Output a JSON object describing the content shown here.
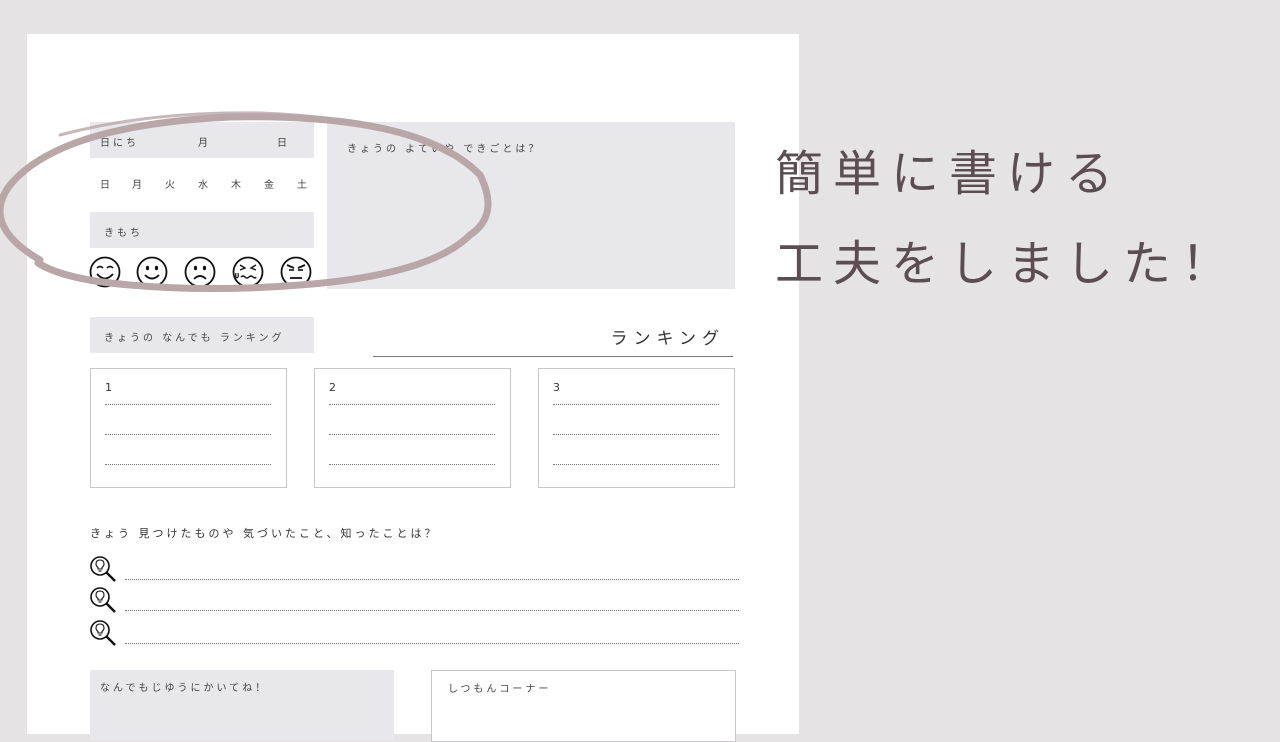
{
  "date": {
    "label": "日にち",
    "month": "月",
    "day": "日"
  },
  "weekdays": [
    "日",
    "月",
    "火",
    "水",
    "木",
    "金",
    "土"
  ],
  "mood": {
    "label": "きもち",
    "faces": [
      "happy-face-icon",
      "smile-face-icon",
      "sad-face-icon",
      "crying-face-icon",
      "angry-face-icon"
    ]
  },
  "good_things": {
    "label": "きょうの よていや できごとは？"
  },
  "ranking": {
    "label": "きょうの なんでも ランキング",
    "title": "ランキング",
    "cards": [
      {
        "num": "1"
      },
      {
        "num": "2"
      },
      {
        "num": "3"
      }
    ]
  },
  "found": {
    "label": "きょう 見つけたものや 気づいたこと、知ったことは？",
    "icon": "lightbulb-magnifier-icon"
  },
  "free_write": {
    "label": "なんでもじゆうにかいてね！"
  },
  "question_corner": {
    "label": "しつもんコーナー"
  },
  "caption": {
    "line1": "簡単に書ける",
    "line2": "工夫をしました！"
  },
  "colors": {
    "background": "#e6e3e5",
    "box_gray": "#e8e7ec",
    "circle_mark": "#b9a6a9",
    "caption_text": "#5a4e52"
  }
}
